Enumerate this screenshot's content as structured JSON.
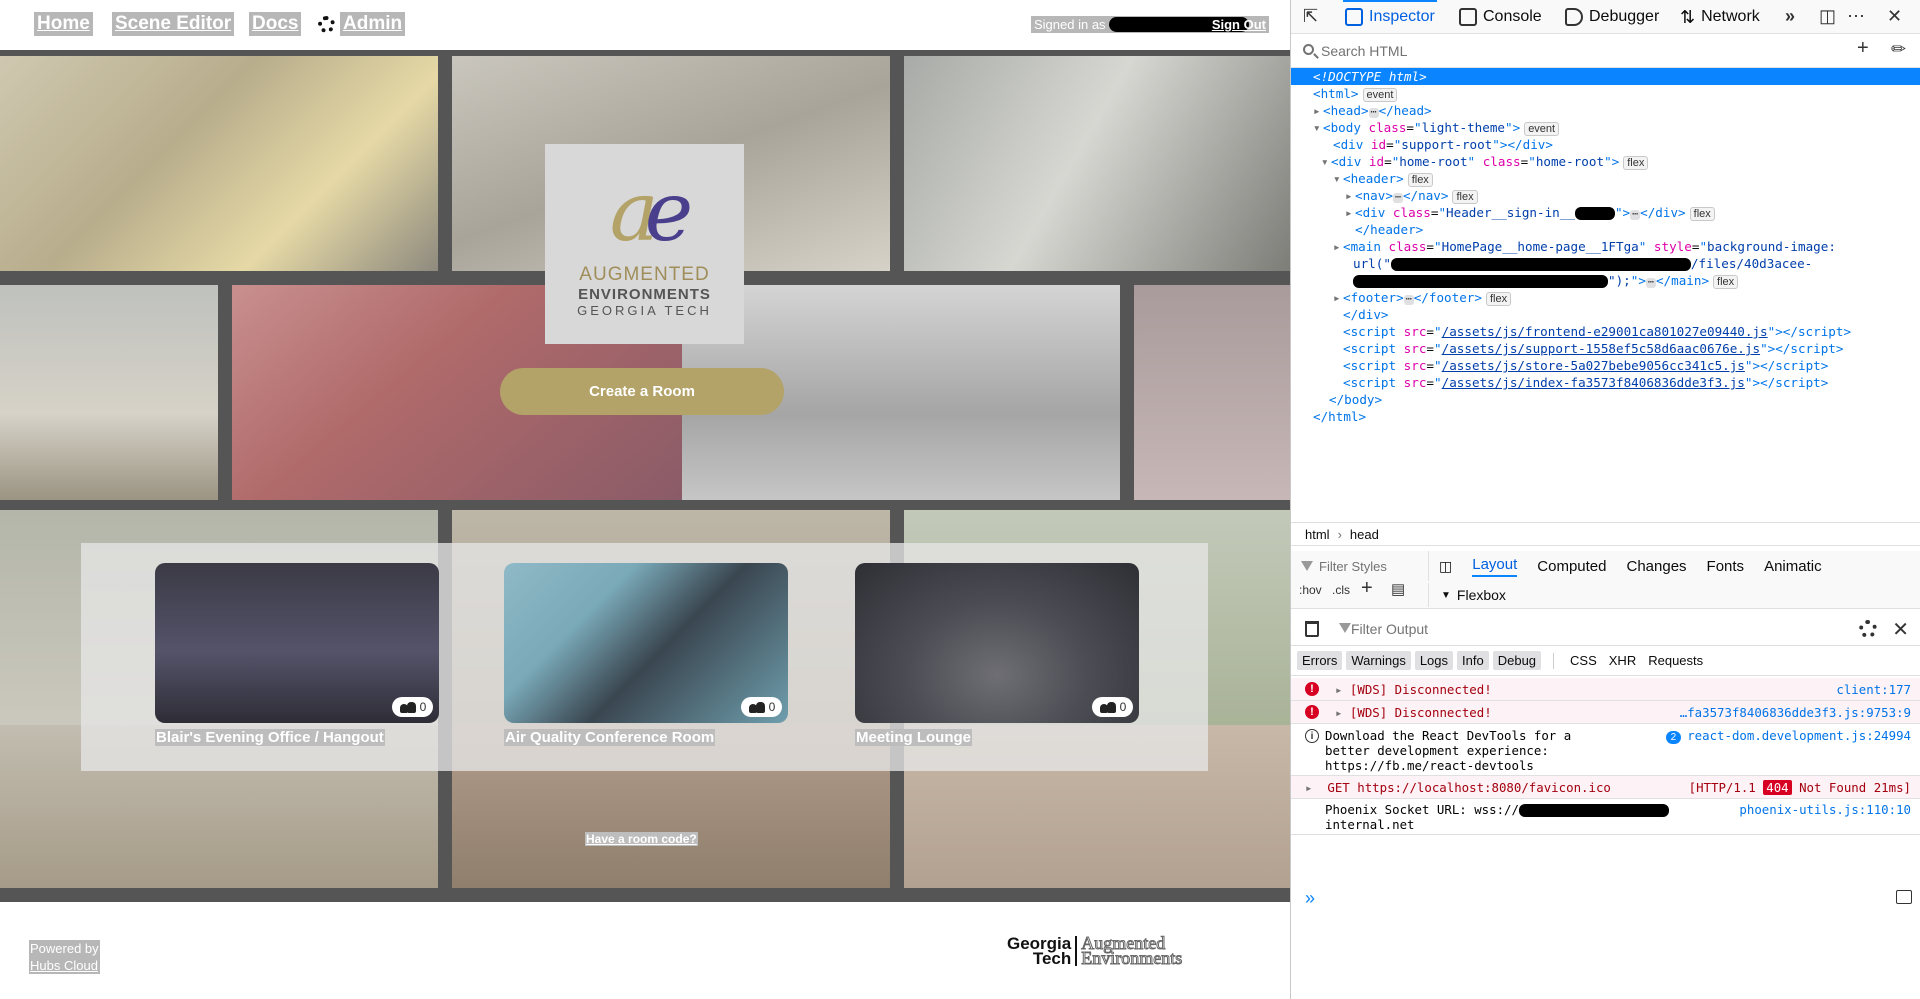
{
  "nav": {
    "home": "Home",
    "scene_editor": "Scene Editor",
    "docs": "Docs",
    "admin": "Admin"
  },
  "header": {
    "signed_in": "Signed in as",
    "sign_out": "Sign Out"
  },
  "logo": {
    "line1": "AUGMENTED",
    "line2": "ENVIRONMENTS",
    "line3": "GEORGIA TECH"
  },
  "hero": {
    "create_room": "Create a Room",
    "room_code": "Have a room code?",
    "rooms": [
      {
        "name": "Blair's Evening Office / Hangout",
        "count": "0"
      },
      {
        "name": "Air Quality Conference Room",
        "count": "0"
      },
      {
        "name": "Meeting Lounge",
        "count": "0"
      }
    ]
  },
  "footer": {
    "powered_by": "Powered by",
    "hubs_cloud": "Hubs Cloud",
    "gt_line1": "Georgia",
    "gt_line2": "Tech",
    "ae_line1": "Augmented",
    "ae_line2": "Environments"
  },
  "devtools": {
    "tabs": {
      "inspector": "Inspector",
      "console": "Console",
      "debugger": "Debugger",
      "network": "Network"
    },
    "search_placeholder": "Search HTML",
    "markup": {
      "doctype": "<!DOCTYPE html>",
      "event_badge": "event",
      "flex_badge": "flex",
      "head": "head",
      "body_class": "light-theme",
      "support_root": "support-root",
      "home_root_id": "home-root",
      "home_root_class": "home-root",
      "header": "header",
      "nav": "nav",
      "signin_class": "Header__sign-in__",
      "main_class": "HomePage__home-page__1FTga",
      "main_style_start": "background-image:",
      "main_style_url": "url(\"",
      "main_style_files": "/files/40d3acee-",
      "main_style_end": "\");",
      "footer": "footer",
      "scripts": [
        "/assets/js/frontend-e29001ca801027e09440.js",
        "/assets/js/support-1558ef5c58d6aac0676e.js",
        "/assets/js/store-5a027bebe9056cc341c5.js",
        "/assets/js/index-fa3573f8406836dde3f3.js"
      ]
    },
    "breadcrumb": {
      "html": "html",
      "head": "head"
    },
    "rules": {
      "filter_placeholder": "Filter Styles",
      "hov": ":hov",
      "cls": ".cls",
      "tabs": [
        "Layout",
        "Computed",
        "Changes",
        "Fonts",
        "Animatic"
      ],
      "flexbox": "Flexbox"
    },
    "console": {
      "filter_placeholder": "Filter Output",
      "filters": [
        "Errors",
        "Warnings",
        "Logs",
        "Info",
        "Debug"
      ],
      "filters_plain": [
        "CSS",
        "XHR",
        "Requests"
      ],
      "messages": [
        {
          "text": "[WDS] Disconnected!",
          "source": "client:177"
        },
        {
          "text": "[WDS] Disconnected!",
          "source": "…fa3573f8406836dde3f3.js:9753:9"
        },
        {
          "text": "Download the React DevTools for a\nbetter development experience:\nhttps://fb.me/react-devtools",
          "count": "2",
          "source": "react-dom.development.js:24994"
        },
        {
          "text": "GET https://localhost:8080/favicon.ico",
          "status_pre": "[HTTP/1.1",
          "status_code": "404",
          "status_post": "Not Found 21ms]"
        },
        {
          "text_pre": "Phoenix Socket URL: wss://",
          "text_post": "internal.net",
          "source": "phoenix-utils.js:110:10"
        }
      ]
    }
  }
}
